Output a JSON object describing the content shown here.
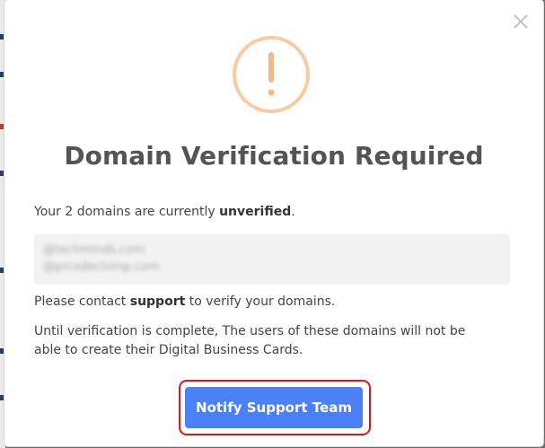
{
  "modal": {
    "title": "Domain Verification Required",
    "intro_prefix": "Your 2 domains are currently ",
    "intro_status": "unverified",
    "intro_suffix": ".",
    "domains": [
      "@techminds.com",
      "@prcodechimp.com"
    ],
    "contact_prefix": "Please contact ",
    "contact_strong": "support",
    "contact_suffix": " to verify your domains.",
    "note_line1": "Until verification is complete, The users of these domains will not be",
    "note_line2": "able to create their Digital Business Cards.",
    "notify_button_label": "Notify Support Team",
    "close_icon": "close-icon",
    "alert_icon": "exclamation-circle-icon"
  },
  "colors": {
    "accent": "#4a7ff5",
    "alert_ring": "#f7cba4",
    "alert_mark": "#f5b987",
    "highlight": "#e0141f"
  }
}
